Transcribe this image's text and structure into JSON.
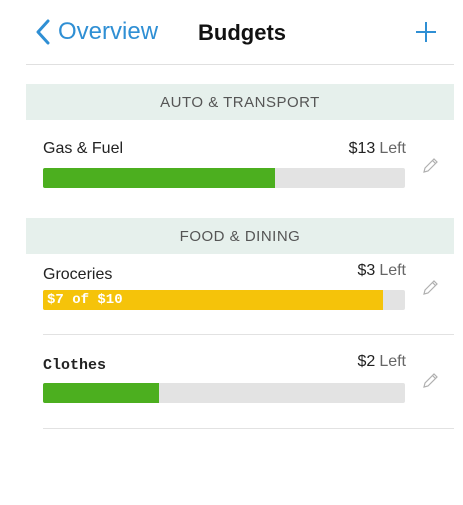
{
  "nav": {
    "back_label": "Overview",
    "title": "Budgets",
    "add_icon": "plus-icon",
    "back_icon": "chevron-left-icon"
  },
  "colors": {
    "accent": "#2f8fd4",
    "section_bg": "#e6f0ec",
    "bar_green": "#4caf1f",
    "bar_yellow": "#f5c30a",
    "bar_track": "#e3e3e3"
  },
  "sections": [
    {
      "header": "AUTO & TRANSPORT",
      "items": [
        {
          "name": "Gas & Fuel",
          "amount": "$13",
          "left_label": "Left",
          "progress": 0.64,
          "color": "#4caf1f",
          "bar_text": "",
          "icon": "pencil-icon"
        }
      ]
    },
    {
      "header": "FOOD & DINING",
      "items": [
        {
          "name": "Groceries",
          "amount": "$3",
          "left_label": "Left",
          "progress": 0.94,
          "color": "#f5c30a",
          "bar_text": "$7 of $10",
          "icon": "pencil-icon"
        },
        {
          "name": "Clothes",
          "amount": "$2",
          "left_label": "Left",
          "progress": 0.32,
          "color": "#4caf1f",
          "bar_text": "",
          "icon": "pencil-icon"
        }
      ]
    }
  ]
}
